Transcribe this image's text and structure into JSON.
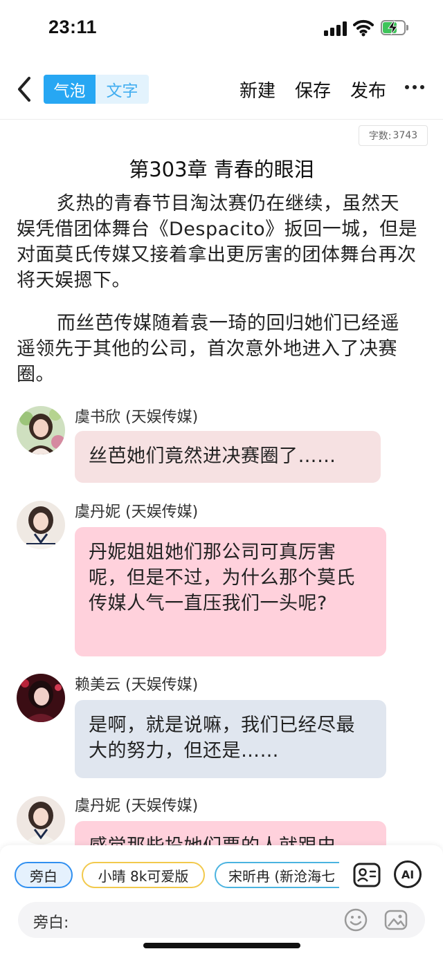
{
  "status_bar": {
    "time": "23:11",
    "battery_color": "#3ec45a"
  },
  "toolbar": {
    "back_icon": "chevron-left-icon",
    "mode_tabs": [
      "气泡",
      "文字"
    ],
    "active_mode": "气泡",
    "new_label": "新建",
    "save_label": "保存",
    "publish_label": "发布",
    "more_icon": "more-horizontal-icon"
  },
  "word_count": {
    "label": "字数:",
    "value": "3743"
  },
  "chapter": {
    "title": "第303章 青春的眼泪",
    "paragraphs": [
      "炙热的青春节目淘汰赛仍在继续，虽然天娱凭借团体舞台《Despacito》扳回一城，但是对面莫氏传媒又接着拿出更厉害的团体舞台再次将天娱摁下。",
      "而丝芭传媒随着袁一琦的回归她们已经遥遥领先于其他的公司，首次意外地进入了决赛圈。"
    ]
  },
  "messages": [
    {
      "speaker": "虞书欣 (天娱传媒)",
      "text": "丝芭她们竟然进决赛圈了……",
      "bubble_color": "#f6e1e2"
    },
    {
      "speaker": "虞丹妮 (天娱传媒)",
      "text": "丹妮姐姐她们那公司可真厉害呢，但是不过，为什么那个莫氏传媒人气一直压我们一头呢?",
      "bubble_color": "#ffd1dc"
    },
    {
      "speaker": "赖美云 (天娱传媒)",
      "text": "是啊，就是说嘛，我们已经尽最大的努力，但还是……",
      "bubble_color": "#e0e6ef"
    },
    {
      "speaker": "虞丹妮 (天娱传媒)",
      "text": "感觉那些投她们票的人就跟史",
      "bubble_color": "#ffd1dc"
    }
  ],
  "role_chips": [
    {
      "label": "旁白",
      "selected": true,
      "border": "#2f8ff0",
      "bg": "#e5f1fd"
    },
    {
      "label": "小晴 8k可爱版",
      "selected": false,
      "border": "#f2c94c",
      "bg": "#ffffff"
    },
    {
      "label": "宋昕冉 (新沧海七",
      "selected": false,
      "border": "#4ab3e0",
      "bg": "#ffffff"
    }
  ],
  "side_buttons": {
    "contact_icon": "contact-card-icon",
    "ai_label": "AI"
  },
  "input": {
    "prefix": "旁白:",
    "emoji_icon": "smiley-icon",
    "image_icon": "image-icon"
  }
}
